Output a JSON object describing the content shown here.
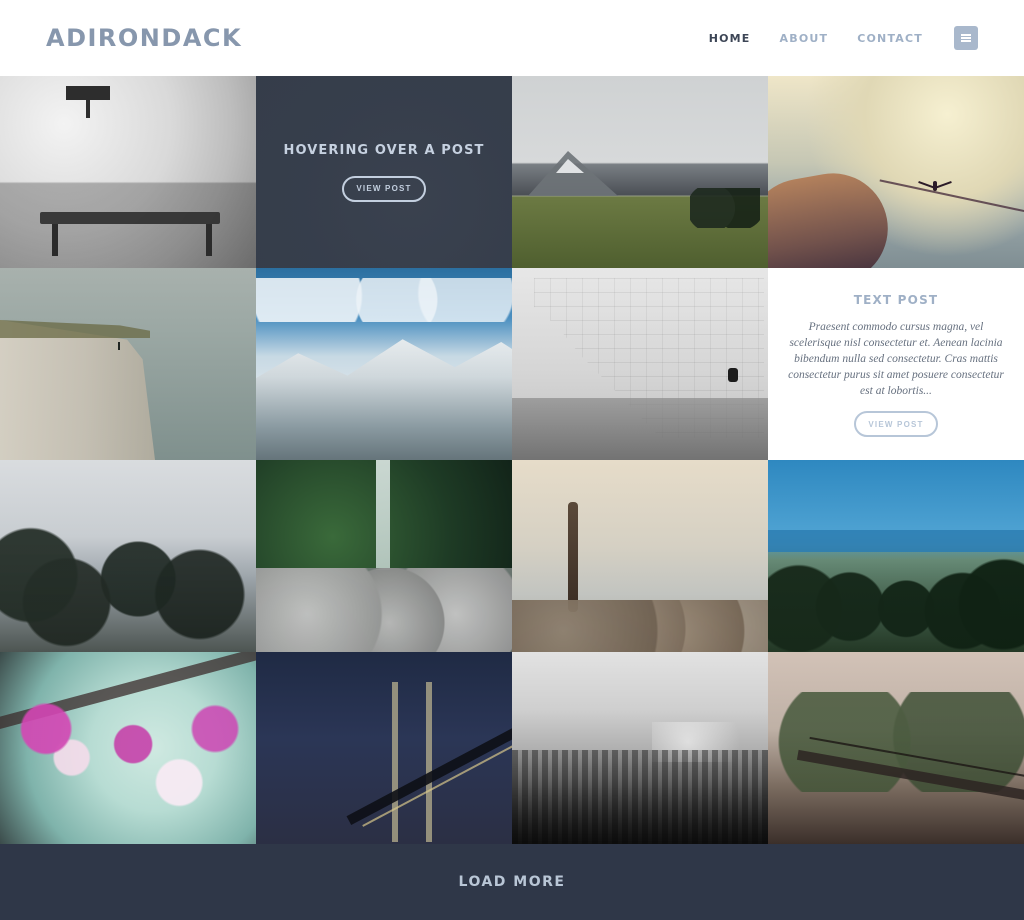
{
  "header": {
    "logo": "ADIRONDACK",
    "nav": [
      {
        "label": "HOME",
        "active": true
      },
      {
        "label": "ABOUT",
        "active": false
      },
      {
        "label": "CONTACT",
        "active": false
      }
    ],
    "menu_icon": "hamburger-menu-icon"
  },
  "grid": {
    "hover_post": {
      "title": "HOVERING OVER A POST",
      "button_label": "VIEW POST"
    },
    "text_post": {
      "title": "TEXT POST",
      "excerpt": "Praesent commodo cursus magna, vel scelerisque nisl consectetur et. Aenean lacinia bibendum nulla sed consectetur. Cras mattis consectetur purus sit amet posuere consectetur est at lobortis...",
      "button_label": "VIEW POST"
    }
  },
  "footer": {
    "load_more_label": "LOAD MORE"
  },
  "colors": {
    "header_bg": "#ffffff",
    "footer_bg": "#2f3748",
    "accent": "#9fb0c6"
  }
}
